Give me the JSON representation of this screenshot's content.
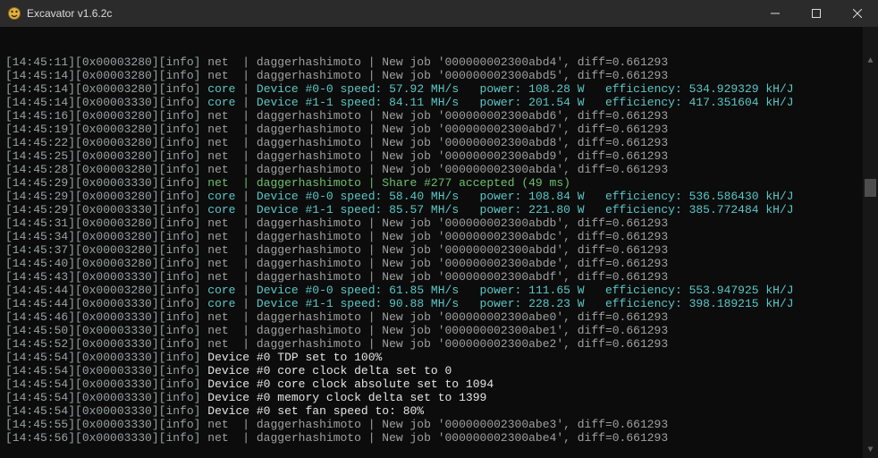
{
  "window": {
    "title": "Excavator v1.6.2c"
  },
  "format": {
    "net_job": "net  | daggerhashimoto | New job '{job}', diff={diff}",
    "core": "core | Device #{dev} speed: {speed} MH/s   power: {power} W   efficiency: {eff} kH/J",
    "share": "net  | daggerhashimoto | Share #{n} accepted ({ms} ms)"
  },
  "diff": 0.661293,
  "log": [
    {
      "t": "14:45:11",
      "thr": "0x00003280",
      "k": "job",
      "job": "000000002300abd4"
    },
    {
      "t": "14:45:14",
      "thr": "0x00003280",
      "k": "job",
      "job": "000000002300abd5"
    },
    {
      "t": "14:45:14",
      "thr": "0x00003280",
      "k": "core",
      "dev": "0-0",
      "speed": "57.92",
      "power": "108.28",
      "eff": "534.929329"
    },
    {
      "t": "14:45:14",
      "thr": "0x00003330",
      "k": "core",
      "dev": "1-1",
      "speed": "84.11",
      "power": "201.54",
      "eff": "417.351604"
    },
    {
      "t": "14:45:16",
      "thr": "0x00003280",
      "k": "job",
      "job": "000000002300abd6"
    },
    {
      "t": "14:45:19",
      "thr": "0x00003280",
      "k": "job",
      "job": "000000002300abd7"
    },
    {
      "t": "14:45:22",
      "thr": "0x00003280",
      "k": "job",
      "job": "000000002300abd8"
    },
    {
      "t": "14:45:25",
      "thr": "0x00003280",
      "k": "job",
      "job": "000000002300abd9"
    },
    {
      "t": "14:45:28",
      "thr": "0x00003280",
      "k": "job",
      "job": "000000002300abda"
    },
    {
      "t": "14:45:29",
      "thr": "0x00003330",
      "k": "share",
      "n": 277,
      "ms": 49
    },
    {
      "t": "14:45:29",
      "thr": "0x00003280",
      "k": "core",
      "dev": "0-0",
      "speed": "58.40",
      "power": "108.84",
      "eff": "536.586430"
    },
    {
      "t": "14:45:29",
      "thr": "0x00003330",
      "k": "core",
      "dev": "1-1",
      "speed": "85.57",
      "power": "221.80",
      "eff": "385.772484"
    },
    {
      "t": "14:45:31",
      "thr": "0x00003280",
      "k": "job",
      "job": "000000002300abdb"
    },
    {
      "t": "14:45:34",
      "thr": "0x00003280",
      "k": "job",
      "job": "000000002300abdc"
    },
    {
      "t": "14:45:37",
      "thr": "0x00003280",
      "k": "job",
      "job": "000000002300abdd"
    },
    {
      "t": "14:45:40",
      "thr": "0x00003280",
      "k": "job",
      "job": "000000002300abde"
    },
    {
      "t": "14:45:43",
      "thr": "0x00003330",
      "k": "job",
      "job": "000000002300abdf"
    },
    {
      "t": "14:45:44",
      "thr": "0x00003280",
      "k": "core",
      "dev": "0-0",
      "speed": "61.85",
      "power": "111.65",
      "eff": "553.947925"
    },
    {
      "t": "14:45:44",
      "thr": "0x00003330",
      "k": "core",
      "dev": "1-1",
      "speed": "90.88",
      "power": "228.23",
      "eff": "398.189215"
    },
    {
      "t": "14:45:46",
      "thr": "0x00003330",
      "k": "job",
      "job": "000000002300abe0"
    },
    {
      "t": "14:45:50",
      "thr": "0x00003330",
      "k": "job",
      "job": "000000002300abe1"
    },
    {
      "t": "14:45:52",
      "thr": "0x00003330",
      "k": "job",
      "job": "000000002300abe2"
    },
    {
      "t": "14:45:54",
      "thr": "0x00003330",
      "k": "txt",
      "text": "Device #0 TDP set to 100%"
    },
    {
      "t": "14:45:54",
      "thr": "0x00003330",
      "k": "txt",
      "text": "Device #0 core clock delta set to 0"
    },
    {
      "t": "14:45:54",
      "thr": "0x00003330",
      "k": "txt",
      "text": "Device #0 core clock absolute set to 1094"
    },
    {
      "t": "14:45:54",
      "thr": "0x00003330",
      "k": "txt",
      "text": "Device #0 memory clock delta set to 1399"
    },
    {
      "t": "14:45:54",
      "thr": "0x00003330",
      "k": "txt",
      "text": "Device #0 set fan speed to: 80%"
    },
    {
      "t": "14:45:55",
      "thr": "0x00003330",
      "k": "job",
      "job": "000000002300abe3"
    },
    {
      "t": "14:45:56",
      "thr": "0x00003330",
      "k": "job",
      "job": "000000002300abe4"
    }
  ]
}
